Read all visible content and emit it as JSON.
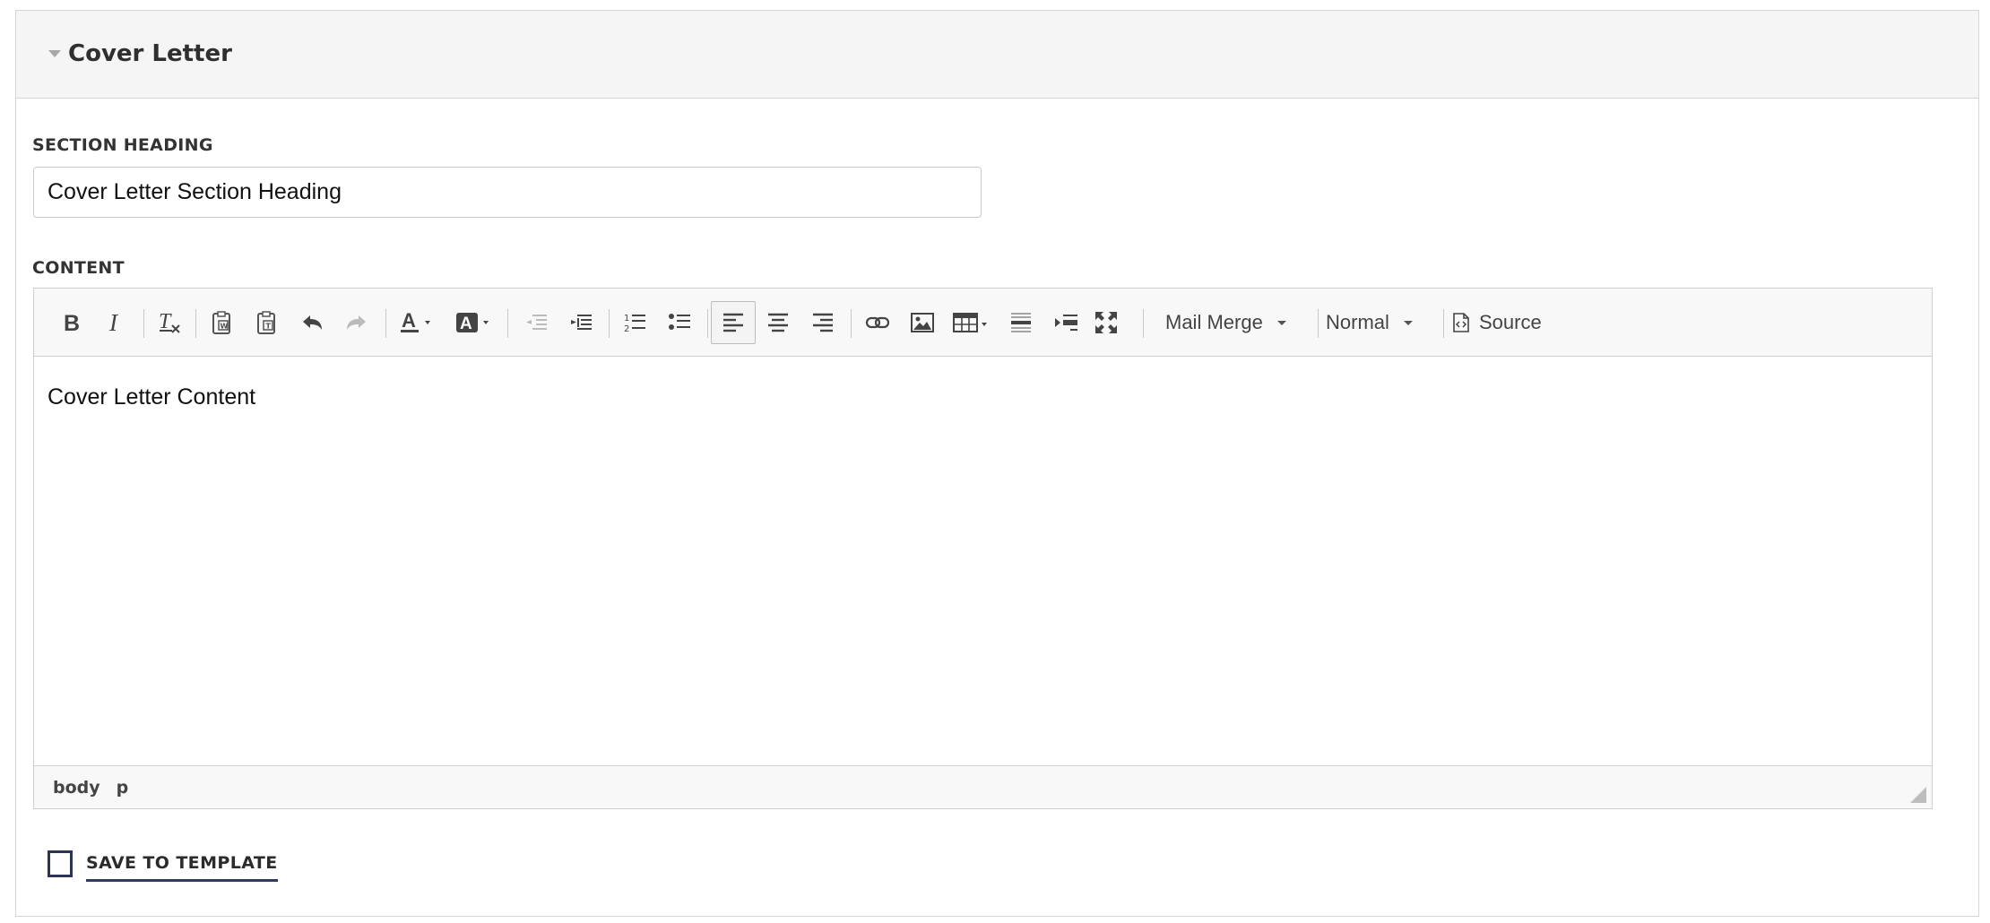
{
  "panel": {
    "title": "Cover Letter",
    "collapse_icon": "caret-down-icon"
  },
  "section_heading": {
    "label": "SECTION HEADING",
    "value": "Cover Letter Section Heading"
  },
  "content": {
    "label": "CONTENT",
    "toolbar": {
      "mail_merge_label": "Mail Merge",
      "format_label": "Normal",
      "source_label": "Source",
      "buttons": [
        "bold-icon",
        "italic-icon",
        "remove-format-icon",
        "paste-from-word-icon",
        "paste-as-text-icon",
        "undo-icon",
        "redo-icon",
        "text-color-icon",
        "background-color-icon",
        "outdent-icon",
        "indent-icon",
        "numbered-list-icon",
        "bulleted-list-icon",
        "align-left-icon",
        "align-center-icon",
        "align-right-icon",
        "link-icon",
        "image-icon",
        "table-icon",
        "horizontal-line-icon",
        "page-break-icon",
        "maximize-icon",
        "source-icon"
      ]
    },
    "body_text": "Cover Letter Content",
    "path": [
      "body",
      "p"
    ]
  },
  "save_to_template": {
    "label": "SAVE TO TEMPLATE",
    "checked": false
  },
  "colors": {
    "accent": "#2e3a66",
    "header_bg": "#f5f5f5",
    "border": "#d6d6d6"
  }
}
